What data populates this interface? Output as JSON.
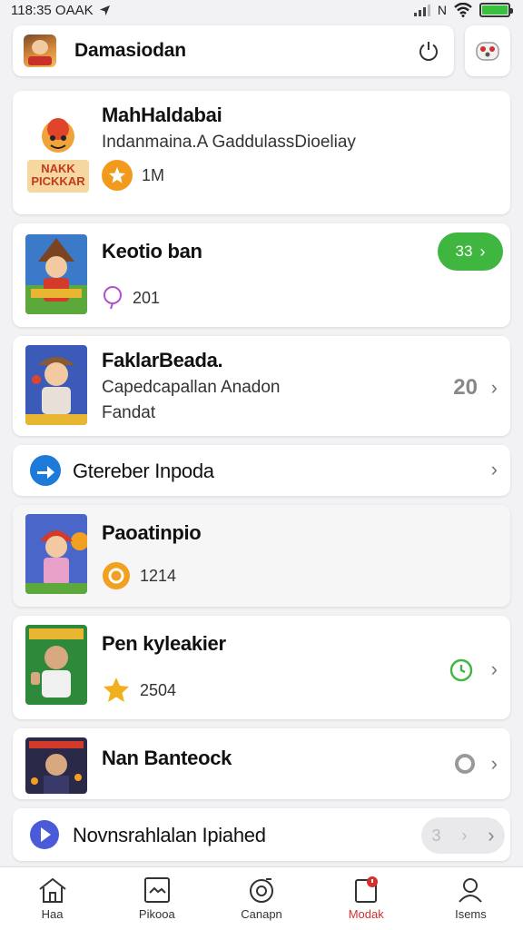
{
  "status_bar": {
    "time": "118:35 OAAK"
  },
  "header": {
    "title": "Damasiodan"
  },
  "cards": [
    {
      "title": "MahHaldabai",
      "subtitle": "Indanmaina.A GaddulassDioeliay",
      "thumb_text": "NAKK PICKKAR",
      "meta": "1M"
    },
    {
      "title": "Keotio ban",
      "meta": "201",
      "pill": "33"
    },
    {
      "title": "FaklarBeada.",
      "subtitle": "Capedcapallan Anadon",
      "subtitle2": "Fandat",
      "count": "20"
    },
    {
      "title": "Gtereber Inpoda"
    },
    {
      "title": "Paoatinpio",
      "meta": "1214"
    },
    {
      "title": "Pen kyleakier",
      "meta": "2504"
    },
    {
      "title": "Nan Banteock"
    },
    {
      "title": "Novnsrahlalan Ipiahed",
      "pill": "3"
    }
  ],
  "nav": [
    {
      "label": "Haa",
      "icon": "home-icon"
    },
    {
      "label": "Pikooa",
      "icon": "image-icon"
    },
    {
      "label": "Canapn",
      "icon": "camera-icon"
    },
    {
      "label": "Modak",
      "icon": "notification-icon",
      "active": true
    },
    {
      "label": "Isems",
      "icon": "profile-icon"
    }
  ],
  "colors": {
    "accent_green": "#3fb63f",
    "active_red": "#d43030",
    "badge_orange": "#f29a1c"
  }
}
